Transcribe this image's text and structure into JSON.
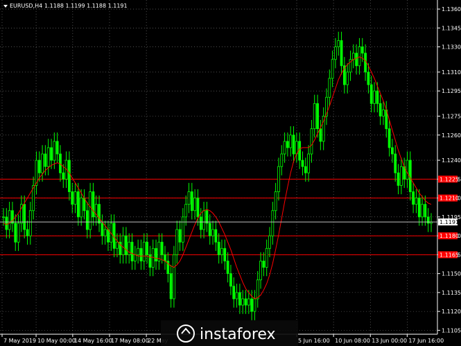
{
  "header": {
    "symbol": "EURUSD,H4",
    "ohlc": "1.1188 1.1199 1.1188 1.1191"
  },
  "watermark": {
    "text": "instaforex"
  },
  "colors": {
    "background": "#000000",
    "candle": "#00ff00",
    "ma": "#ff0000",
    "level_line": "#ff0000",
    "level_label_bg": "#ff0000",
    "current_price_line": "#c0c0c0",
    "axis": "#ffffff"
  },
  "chart_data": {
    "type": "candlestick",
    "ylim": [
      1.1103,
      1.1365
    ],
    "y_ticks": [
      "1.1360",
      "1.1345",
      "1.1330",
      "1.1310",
      "1.1295",
      "1.1275",
      "1.1260",
      "1.1240",
      "1.1225",
      "1.1210",
      "1.1195",
      "1.1180",
      "1.1165",
      "1.1150",
      "1.1135",
      "1.1120",
      "1.1105"
    ],
    "x_ticks": [
      "7 May 2019",
      "10 May 00:00",
      "14 May 16:00",
      "17 May 08:00",
      "22 May",
      "5 Jun 16:00",
      "10 Jun 08:00",
      "13 Jun 00:00",
      "17 Jun 16:00"
    ],
    "x_tick_pos": [
      0.0,
      0.0785,
      0.163,
      0.248,
      0.333,
      0.68,
      0.765,
      0.85,
      0.935
    ],
    "levels": [
      "1.1225",
      "1.1210",
      "1.1180",
      "1.1165"
    ],
    "current_price": "1.1191",
    "close": [
      1.1195,
      1.1185,
      1.12,
      1.119,
      1.1175,
      1.119,
      1.1205,
      1.1185,
      1.118,
      1.12,
      1.122,
      1.124,
      1.123,
      1.1245,
      1.1235,
      1.125,
      1.124,
      1.1255,
      1.1245,
      1.123,
      1.1225,
      1.124,
      1.1215,
      1.1205,
      1.1215,
      1.1195,
      1.121,
      1.12,
      1.1185,
      1.1215,
      1.1195,
      1.1205,
      1.119,
      1.118,
      1.1185,
      1.1175,
      1.119,
      1.117,
      1.1175,
      1.1165,
      1.118,
      1.1165,
      1.1175,
      1.116,
      1.1165,
      1.117,
      1.116,
      1.1175,
      1.1165,
      1.1155,
      1.117,
      1.116,
      1.1175,
      1.1165,
      1.116,
      1.115,
      1.113,
      1.1165,
      1.1185,
      1.1175,
      1.1195,
      1.1205,
      1.1215,
      1.12,
      1.121,
      1.1195,
      1.1185,
      1.12,
      1.119,
      1.118,
      1.1185,
      1.1175,
      1.1165,
      1.117,
      1.116,
      1.115,
      1.114,
      1.113,
      1.1135,
      1.1125,
      1.113,
      1.1125,
      1.113,
      1.112,
      1.113,
      1.1145,
      1.116,
      1.1155,
      1.117,
      1.118,
      1.12,
      1.1215,
      1.1235,
      1.1245,
      1.1255,
      1.125,
      1.126,
      1.1245,
      1.1255,
      1.124,
      1.1235,
      1.123,
      1.1245,
      1.1265,
      1.1285,
      1.1265,
      1.1255,
      1.1275,
      1.129,
      1.1305,
      1.132,
      1.133,
      1.1335,
      1.1315,
      1.13,
      1.131,
      1.132,
      1.1325,
      1.1315,
      1.133,
      1.1325,
      1.131,
      1.13,
      1.1285,
      1.1295,
      1.1285,
      1.1275,
      1.128,
      1.1265,
      1.125,
      1.1245,
      1.123,
      1.122,
      1.1235,
      1.1225,
      1.124,
      1.1215,
      1.1205,
      1.121,
      1.1195,
      1.1205,
      1.1195,
      1.119,
      1.1191
    ],
    "ma": [
      1.119,
      1.1189,
      1.119,
      1.1192,
      1.1195,
      1.1198,
      1.1202,
      1.1206,
      1.121,
      1.1214,
      1.1218,
      1.1222,
      1.1226,
      1.1229,
      1.1232,
      1.1234,
      1.1236,
      1.1237,
      1.1238,
      1.1237,
      1.1235,
      1.1233,
      1.123,
      1.1226,
      1.1222,
      1.1218,
      1.1214,
      1.121,
      1.1206,
      1.1203,
      1.12,
      1.1197,
      1.1194,
      1.1191,
      1.1188,
      1.1185,
      1.1182,
      1.1179,
      1.1176,
      1.1173,
      1.1171,
      1.1169,
      1.1167,
      1.1166,
      1.1165,
      1.1164,
      1.1164,
      1.1164,
      1.1164,
      1.1163,
      1.1163,
      1.1162,
      1.1162,
      1.1161,
      1.116,
      1.1158,
      1.1156,
      1.1155,
      1.1157,
      1.116,
      1.1165,
      1.1171,
      1.1177,
      1.1183,
      1.1189,
      1.1194,
      1.1198,
      1.12,
      1.1201,
      1.12,
      1.1198,
      1.1195,
      1.1191,
      1.1186,
      1.1181,
      1.1175,
      1.1169,
      1.1162,
      1.1155,
      1.1149,
      1.1143,
      1.1138,
      1.1135,
      1.1132,
      1.113,
      1.1131,
      1.1133,
      1.1137,
      1.1142,
      1.1149,
      1.1158,
      1.1169,
      1.1181,
      1.1194,
      1.1207,
      1.1219,
      1.123,
      1.1239,
      1.1245,
      1.1249,
      1.125,
      1.125,
      1.125,
      1.1252,
      1.1256,
      1.1261,
      1.1266,
      1.1271,
      1.1277,
      1.1283,
      1.129,
      1.1297,
      1.1304,
      1.1309,
      1.1313,
      1.1316,
      1.1318,
      1.132,
      1.1321,
      1.1322,
      1.1321,
      1.1319,
      1.1315,
      1.131,
      1.1305,
      1.1299,
      1.1293,
      1.1287,
      1.128,
      1.1272,
      1.1264,
      1.1256,
      1.1248,
      1.1241,
      1.1235,
      1.123,
      1.1226,
      1.1222,
      1.1218,
      1.1214,
      1.1211,
      1.1208,
      1.1206,
      1.1205
    ]
  }
}
